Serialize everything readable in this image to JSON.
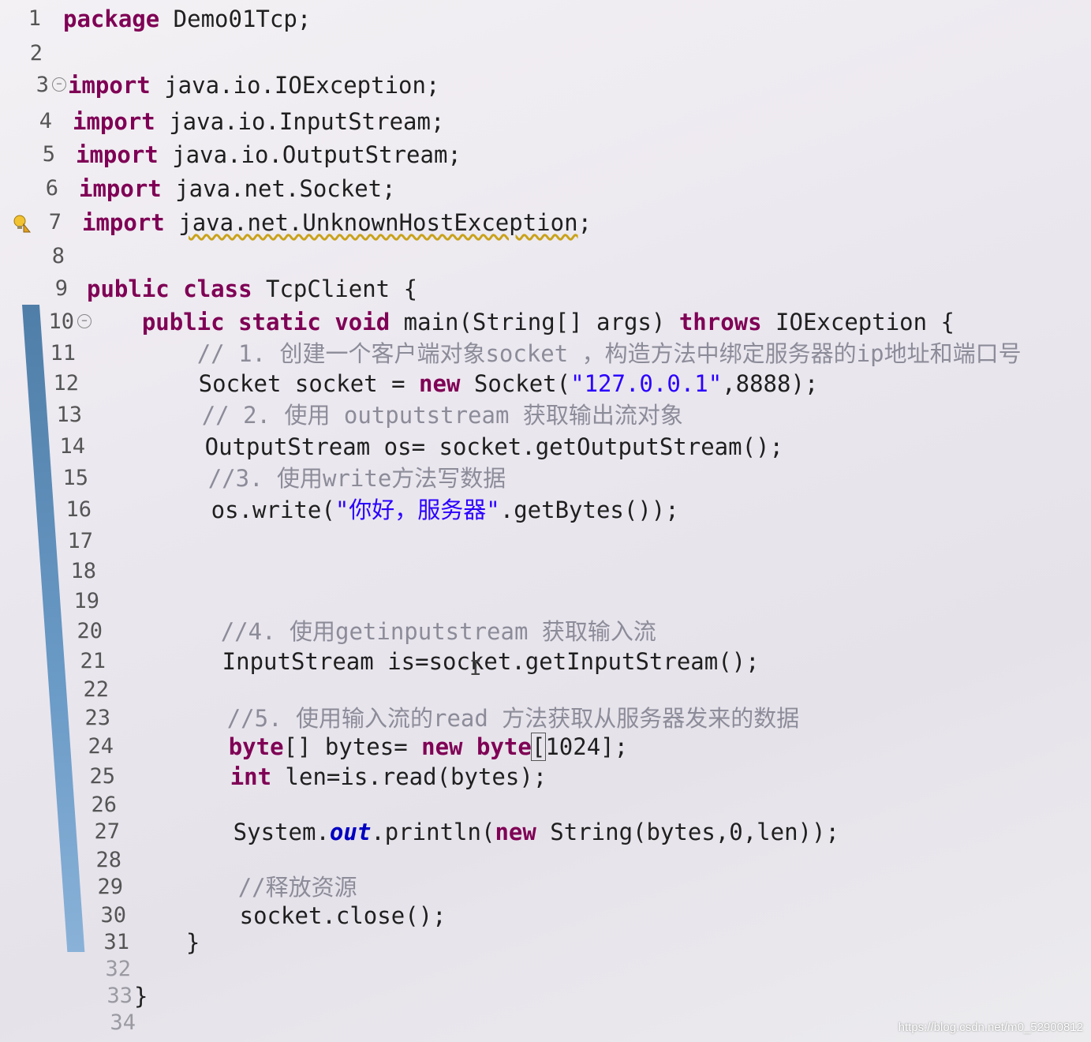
{
  "editor": {
    "lines": [
      {
        "n": "1",
        "parts": [
          {
            "t": "package",
            "c": "kw"
          },
          {
            "t": " Demo01Tcp;",
            "c": ""
          }
        ]
      },
      {
        "n": "2",
        "parts": []
      },
      {
        "n": "3",
        "parts": [
          {
            "t": "import",
            "c": "kw"
          },
          {
            "t": " java.io.IOException;",
            "c": ""
          }
        ]
      },
      {
        "n": "4",
        "parts": [
          {
            "t": "import",
            "c": "kw"
          },
          {
            "t": " java.io.InputStream;",
            "c": ""
          }
        ]
      },
      {
        "n": "5",
        "parts": [
          {
            "t": "import",
            "c": "kw"
          },
          {
            "t": " java.io.OutputStream;",
            "c": ""
          }
        ]
      },
      {
        "n": "6",
        "parts": [
          {
            "t": "import",
            "c": "kw"
          },
          {
            "t": " java.net.Socket;",
            "c": ""
          }
        ]
      },
      {
        "n": "7",
        "parts": [
          {
            "t": "import",
            "c": "kw"
          },
          {
            "t": " ",
            "c": ""
          },
          {
            "t": "java.net.UnknownHostException",
            "c": "warn"
          },
          {
            "t": ";",
            "c": ""
          }
        ]
      },
      {
        "n": "8",
        "parts": []
      },
      {
        "n": "9",
        "parts": [
          {
            "t": "public",
            "c": "kw"
          },
          {
            "t": " ",
            "c": ""
          },
          {
            "t": "class",
            "c": "kw"
          },
          {
            "t": " TcpClient {",
            "c": ""
          }
        ]
      },
      {
        "n": "10",
        "parts": [
          {
            "t": "    ",
            "c": ""
          },
          {
            "t": "public",
            "c": "kw"
          },
          {
            "t": " ",
            "c": ""
          },
          {
            "t": "static",
            "c": "kw"
          },
          {
            "t": " ",
            "c": ""
          },
          {
            "t": "void",
            "c": "kw"
          },
          {
            "t": " main(String[] args) ",
            "c": ""
          },
          {
            "t": "throws",
            "c": "kw"
          },
          {
            "t": " IOException {",
            "c": ""
          }
        ]
      },
      {
        "n": "11",
        "parts": [
          {
            "t": "        ",
            "c": ""
          },
          {
            "t": "// 1. 创建一个客户端对象socket ，构造方法中绑定服务器的ip地址和端口号",
            "c": "cm"
          }
        ]
      },
      {
        "n": "12",
        "parts": [
          {
            "t": "        Socket socket = ",
            "c": ""
          },
          {
            "t": "new",
            "c": "kw"
          },
          {
            "t": " Socket(",
            "c": ""
          },
          {
            "t": "\"127.0.0.1\"",
            "c": "str"
          },
          {
            "t": ",8888);",
            "c": ""
          }
        ]
      },
      {
        "n": "13",
        "parts": [
          {
            "t": "        ",
            "c": ""
          },
          {
            "t": "// 2. 使用 outputstream 获取输出流对象",
            "c": "cm"
          }
        ]
      },
      {
        "n": "14",
        "parts": [
          {
            "t": "        OutputStream os= socket.getOutputStream();",
            "c": ""
          }
        ]
      },
      {
        "n": "15",
        "parts": [
          {
            "t": "        ",
            "c": ""
          },
          {
            "t": "//3. 使用write方法写数据",
            "c": "cm"
          }
        ]
      },
      {
        "n": "16",
        "parts": [
          {
            "t": "        os.write(",
            "c": ""
          },
          {
            "t": "\"你好，服务器\"",
            "c": "str"
          },
          {
            "t": ".getBytes());",
            "c": ""
          }
        ]
      },
      {
        "n": "17",
        "parts": []
      },
      {
        "n": "18",
        "parts": []
      },
      {
        "n": "19",
        "parts": []
      },
      {
        "n": "20",
        "parts": [
          {
            "t": "        ",
            "c": ""
          },
          {
            "t": "//4. 使用getinputstream 获取输入流",
            "c": "cm"
          }
        ]
      },
      {
        "n": "21",
        "parts": [
          {
            "t": "        InputStream is=socket.getInputStream();",
            "c": ""
          }
        ]
      },
      {
        "n": "22",
        "parts": []
      },
      {
        "n": "23",
        "parts": [
          {
            "t": "        ",
            "c": ""
          },
          {
            "t": "//5. 使用输入流的read 方法获取从服务器发来的数据",
            "c": "cm"
          }
        ]
      },
      {
        "n": "24",
        "parts": [
          {
            "t": "        ",
            "c": ""
          },
          {
            "t": "byte",
            "c": "kw"
          },
          {
            "t": "[] bytes= ",
            "c": ""
          },
          {
            "t": "new",
            "c": "kw"
          },
          {
            "t": " ",
            "c": ""
          },
          {
            "t": "byte",
            "c": "kw"
          },
          {
            "t": "[",
            "c": "hl"
          },
          {
            "t": "1024];",
            "c": ""
          }
        ]
      },
      {
        "n": "25",
        "parts": [
          {
            "t": "        ",
            "c": ""
          },
          {
            "t": "int",
            "c": "kw"
          },
          {
            "t": " len=is.read(bytes);",
            "c": ""
          }
        ]
      },
      {
        "n": "26",
        "parts": []
      },
      {
        "n": "27",
        "parts": [
          {
            "t": "        System.",
            "c": ""
          },
          {
            "t": "out",
            "c": "field"
          },
          {
            "t": ".println(",
            "c": ""
          },
          {
            "t": "new",
            "c": "kw"
          },
          {
            "t": " String(bytes,0,len));",
            "c": ""
          }
        ]
      },
      {
        "n": "28",
        "parts": []
      },
      {
        "n": "29",
        "parts": [
          {
            "t": "        ",
            "c": ""
          },
          {
            "t": "//释放资源",
            "c": "cm"
          }
        ]
      },
      {
        "n": "30",
        "parts": [
          {
            "t": "        socket.close();",
            "c": ""
          }
        ]
      },
      {
        "n": "31",
        "parts": [
          {
            "t": "    }",
            "c": ""
          }
        ]
      },
      {
        "n": "32",
        "parts": []
      },
      {
        "n": "33",
        "parts": [
          {
            "t": "}",
            "c": ""
          }
        ]
      },
      {
        "n": "34",
        "parts": []
      }
    ]
  },
  "watermark": "https://blog.csdn.net/m0_52900812",
  "colors": {
    "keyword": "#7f0055",
    "comment": "#8c8c99",
    "string": "#2a00ff",
    "change_bar": "#4f7ea8"
  },
  "icons": {
    "fold": "collapse-fold-icon",
    "quick_fix": "lightbulb-warning-icon",
    "text_cursor": "i-beam-cursor-icon"
  }
}
